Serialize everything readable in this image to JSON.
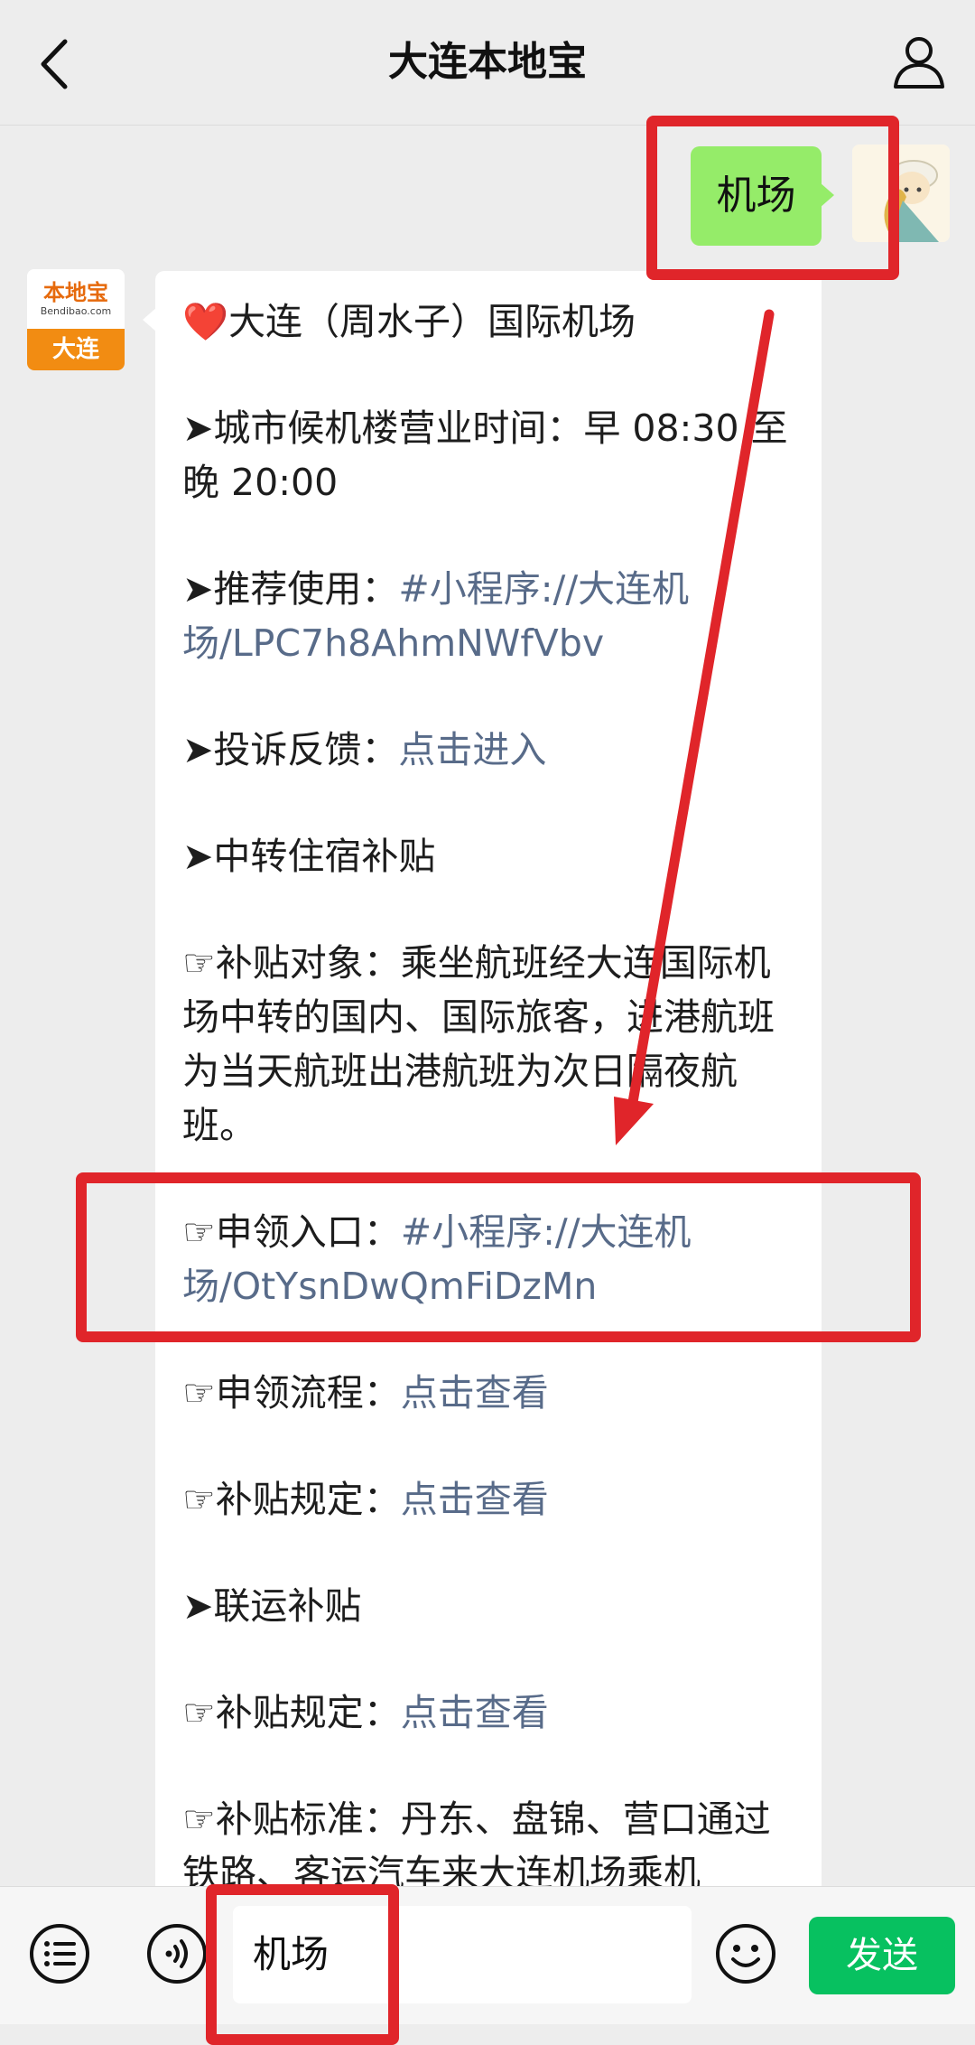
{
  "header": {
    "title": "大连本地宝",
    "back_icon": "chevron-left-icon",
    "user_icon": "person-icon"
  },
  "chat": {
    "user_message": "机场",
    "bot_avatar": {
      "logo": "本地宝",
      "url": "Bendibao.com",
      "city": "大连"
    },
    "bot_message": [
      {
        "type": "text",
        "mark": "❤️",
        "text": "大连（周水子）国际机场"
      },
      {
        "type": "gap"
      },
      {
        "type": "text",
        "mark": "➤ ",
        "text": "城市候机楼营业时间：早 08:30 至晚 20:00"
      },
      {
        "type": "gap"
      },
      {
        "type": "link_line",
        "mark": "➤ ",
        "text": "推荐使用：",
        "link": "#小程序://大连机场/LPC7h8AhmNWfVbv"
      },
      {
        "type": "gap"
      },
      {
        "type": "link_line",
        "mark": "➤ ",
        "text": "投诉反馈：",
        "link": "点击进入"
      },
      {
        "type": "gap"
      },
      {
        "type": "text",
        "mark": "➤ ",
        "text": "中转住宿补贴"
      },
      {
        "type": "gap"
      },
      {
        "type": "text",
        "mark": "☞ ",
        "text": "补贴对象：乘坐航班经大连国际机场中转的国内、国际旅客，进港航班为当天航班出港航班为次日隔夜航班。"
      },
      {
        "type": "gap"
      },
      {
        "type": "link_line",
        "mark": "☞ ",
        "text": "申领入口：",
        "link": "#小程序://大连机场/OtYsnDwQmFiDzMn"
      },
      {
        "type": "gap"
      },
      {
        "type": "link_line",
        "mark": "☞ ",
        "text": "申领流程：",
        "link": "点击查看"
      },
      {
        "type": "gap"
      },
      {
        "type": "link_line",
        "mark": "☞ ",
        "text": "补贴规定：",
        "link": "点击查看"
      },
      {
        "type": "gap"
      },
      {
        "type": "text",
        "mark": "➤ ",
        "text": "联运补贴"
      },
      {
        "type": "gap"
      },
      {
        "type": "link_line",
        "mark": "☞ ",
        "text": "补贴规定：",
        "link": "点击查看"
      },
      {
        "type": "gap"
      },
      {
        "type": "text",
        "mark": "☞ ",
        "text": "补贴标准：丹东、盘锦、营口通过铁路、客运汽车来大连机场乘机"
      }
    ]
  },
  "input_bar": {
    "menu_icon": "list-icon",
    "voice_icon": "voice-icon",
    "input_value": "机场",
    "emoji_icon": "smiley-icon",
    "send_label": "发送"
  },
  "colors": {
    "accent_green": "#07c160",
    "bubble_green": "#95ec69",
    "link": "#586b89",
    "annotation_red": "#e0252a"
  }
}
